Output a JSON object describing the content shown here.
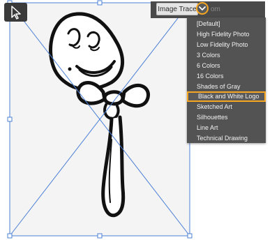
{
  "toolbar": {
    "image_trace_label": "Image Trace",
    "faded_label": "om"
  },
  "preset_menu": {
    "items": [
      {
        "label": "[Default]"
      },
      {
        "label": "High Fidelity Photo"
      },
      {
        "label": "Low Fidelity Photo"
      },
      {
        "label": "3 Colors"
      },
      {
        "label": "6 Colors"
      },
      {
        "label": "16 Colors"
      },
      {
        "label": "Shades of Gray"
      },
      {
        "label": "Black and White Logo",
        "selected": true
      },
      {
        "label": "Sketched Art"
      },
      {
        "label": "Silhouettes"
      },
      {
        "label": "Line Art"
      },
      {
        "label": "Technical Drawing"
      }
    ]
  },
  "colors": {
    "accent_highlight": "#f6a623",
    "selection_line": "#4a7fd6",
    "menu_bg": "#535353"
  },
  "icons": {
    "select_tool": "selection-arrow-icon",
    "dropdown": "chevron-down-icon"
  }
}
